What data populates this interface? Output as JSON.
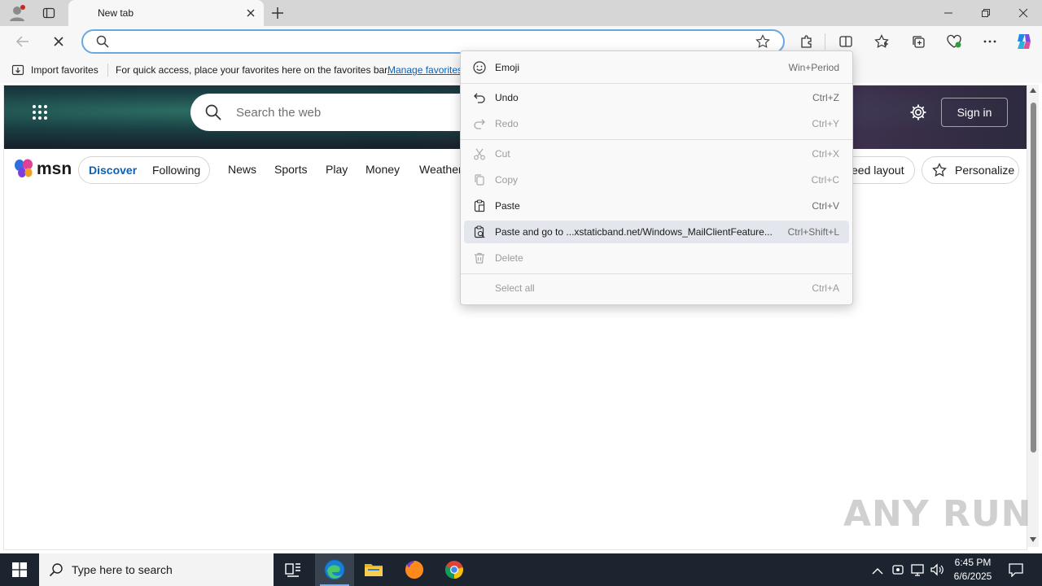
{
  "browser": {
    "tab_title": "New tab",
    "address_value": "",
    "favorites_bar": {
      "import_label": "Import favorites",
      "hint_text": "For quick access, place your favorites here on the favorites bar.",
      "manage_link": "Manage favorites"
    }
  },
  "msn": {
    "logo_text": "msn",
    "search_placeholder": "Search the web",
    "sign_in": "Sign in",
    "nav_tabs": [
      "Discover",
      "Following"
    ],
    "nav_items": [
      "News",
      "Sports",
      "Play",
      "Money",
      "Weather"
    ],
    "feed_layout_label": "eed layout",
    "personalize_label": "Personalize"
  },
  "context_menu": {
    "items": [
      {
        "label": "Emoji",
        "shortcut": "Win+Period",
        "icon": "emoji-icon",
        "enabled": true
      },
      {
        "label": "Undo",
        "shortcut": "Ctrl+Z",
        "icon": "undo-icon",
        "enabled": true
      },
      {
        "label": "Redo",
        "shortcut": "Ctrl+Y",
        "icon": "redo-icon",
        "enabled": false
      },
      {
        "label": "Cut",
        "shortcut": "Ctrl+X",
        "icon": "cut-icon",
        "enabled": false
      },
      {
        "label": "Copy",
        "shortcut": "Ctrl+C",
        "icon": "copy-icon",
        "enabled": false
      },
      {
        "label": "Paste",
        "shortcut": "Ctrl+V",
        "icon": "paste-icon",
        "enabled": true
      },
      {
        "label": "Paste and go to ...xstaticband.net/Windows_MailClientFeature...",
        "shortcut": "Ctrl+Shift+L",
        "icon": "paste-go-icon",
        "enabled": true,
        "highlighted": true
      },
      {
        "label": "Delete",
        "shortcut": "",
        "icon": "delete-icon",
        "enabled": false
      },
      {
        "label": "Select all",
        "shortcut": "Ctrl+A",
        "icon": "",
        "enabled": false
      }
    ]
  },
  "watermark": "ANY RUN",
  "taskbar": {
    "search_placeholder": "Type here to search",
    "time": "6:45 PM",
    "date": "6/6/2025"
  },
  "colors": {
    "accent": "#0b61b5",
    "address_border": "#6aa7e0",
    "taskbar": "#1c2430",
    "menu_highlight": "#e3e6ec"
  }
}
